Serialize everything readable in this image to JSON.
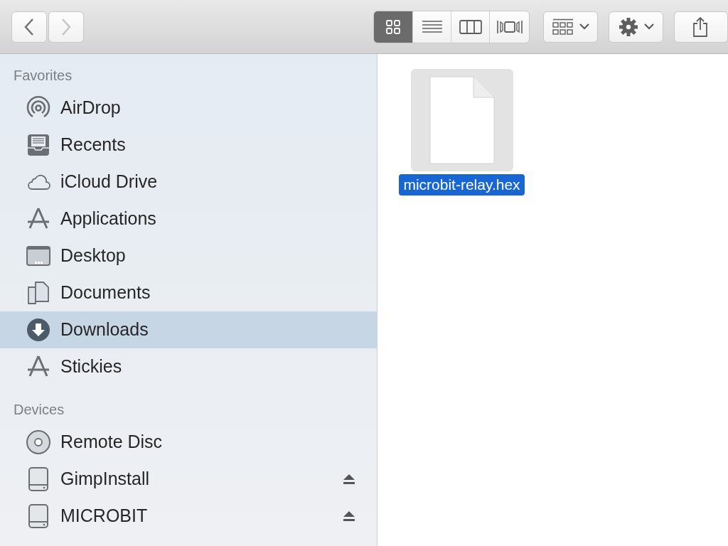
{
  "toolbar": {
    "nav": [
      {
        "kind": "back",
        "disabled": false
      },
      {
        "kind": "forward",
        "disabled": true
      }
    ],
    "views": [
      {
        "kind": "icons",
        "selected": true
      },
      {
        "kind": "list",
        "selected": false
      },
      {
        "kind": "columns",
        "selected": false
      },
      {
        "kind": "gallery",
        "selected": false
      }
    ]
  },
  "sidebar": {
    "sections": [
      {
        "title": "Favorites",
        "items": [
          {
            "label": "AirDrop",
            "kind": "airdrop",
            "selected": false,
            "ejectable": false
          },
          {
            "label": "Recents",
            "kind": "recents",
            "selected": false,
            "ejectable": false
          },
          {
            "label": "iCloud Drive",
            "kind": "cloud",
            "selected": false,
            "ejectable": false
          },
          {
            "label": "Applications",
            "kind": "apps",
            "selected": false,
            "ejectable": false
          },
          {
            "label": "Desktop",
            "kind": "desktop",
            "selected": false,
            "ejectable": false
          },
          {
            "label": "Documents",
            "kind": "documents",
            "selected": false,
            "ejectable": false
          },
          {
            "label": "Downloads",
            "kind": "downloads",
            "selected": true,
            "ejectable": false
          },
          {
            "label": "Stickies",
            "kind": "apps",
            "selected": false,
            "ejectable": false
          }
        ]
      },
      {
        "title": "Devices",
        "items": [
          {
            "label": "Remote Disc",
            "kind": "disc",
            "selected": false,
            "ejectable": false
          },
          {
            "label": "GimpInstall",
            "kind": "drive",
            "selected": false,
            "ejectable": true
          },
          {
            "label": "MICROBIT",
            "kind": "drive",
            "selected": false,
            "ejectable": true
          }
        ]
      }
    ]
  },
  "files": [
    {
      "name": "microbit-relay.hex",
      "selected": true
    }
  ]
}
